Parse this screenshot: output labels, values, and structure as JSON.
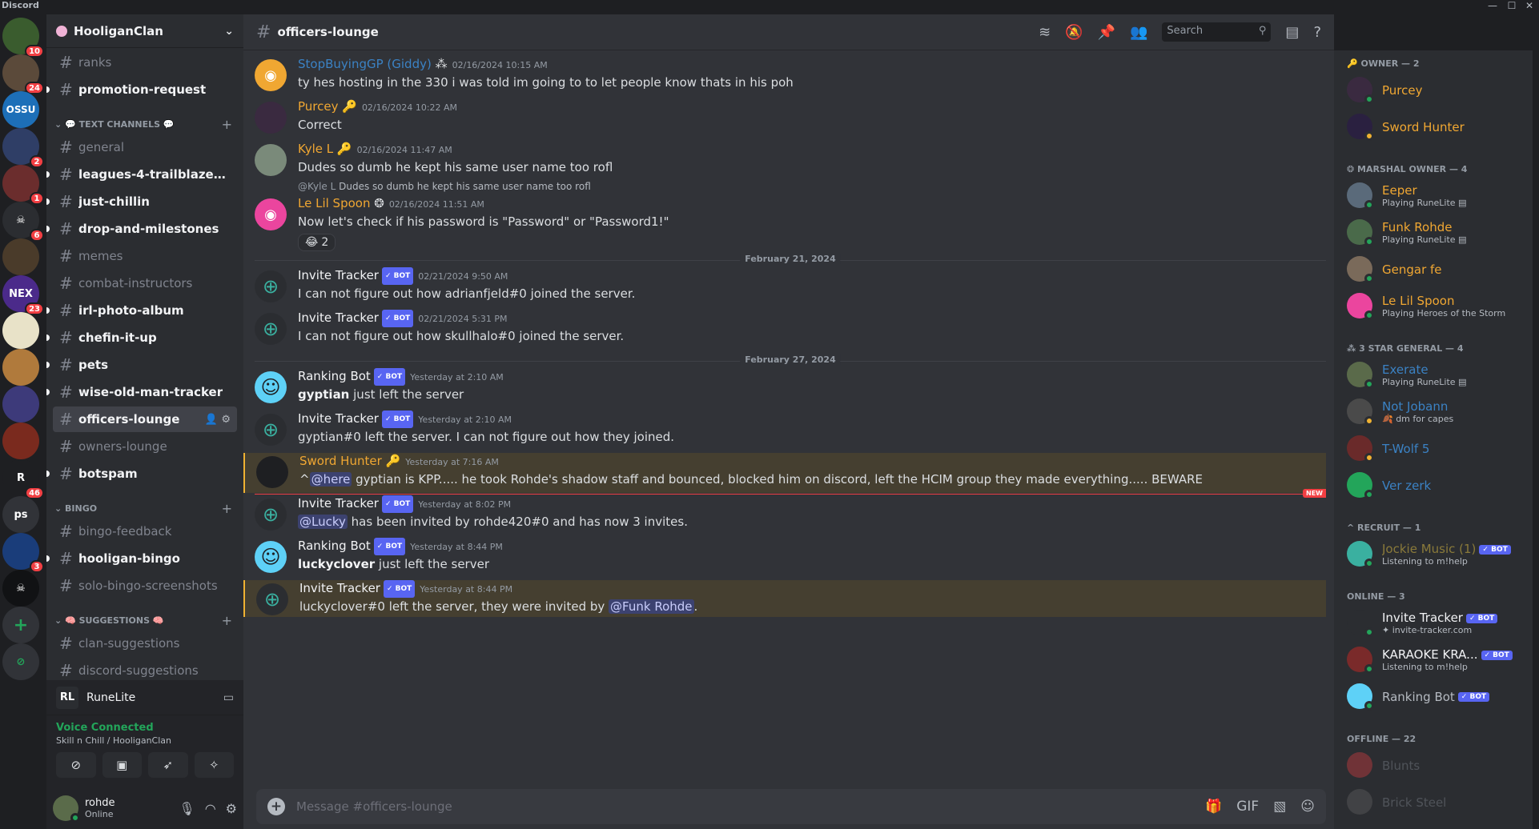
{
  "window": {
    "app_name": "Discord",
    "minimize": "—",
    "maximize": "☐",
    "close": "✕"
  },
  "servers": [
    {
      "label": "",
      "badge": "10",
      "color": "#3a5c2e"
    },
    {
      "label": "",
      "badge": "24",
      "color": "#5b4a3a"
    },
    {
      "label": "OSSU",
      "badge": "",
      "color": "#1d6fb8"
    },
    {
      "label": "",
      "badge": "2",
      "color": "#2f3e66"
    },
    {
      "label": "",
      "badge": "1",
      "color": "#6b2d2d"
    },
    {
      "label": "☠",
      "badge": "6",
      "color": "#2b2d31"
    },
    {
      "label": "",
      "badge": "",
      "color": "#4a3b2a"
    },
    {
      "label": "NEX",
      "badge": "23",
      "color": "#4b2a8a"
    },
    {
      "label": "",
      "badge": "",
      "color": "#e8e2c8"
    },
    {
      "label": "",
      "badge": "",
      "color": "#b07a3c"
    },
    {
      "label": "",
      "badge": "",
      "color": "#3d3a7a"
    },
    {
      "label": "",
      "badge": "",
      "color": "#7a2a1e"
    },
    {
      "label": "R",
      "badge": "46",
      "color": "#1e1f22"
    },
    {
      "label": "ps",
      "badge": "",
      "color": "#313338"
    },
    {
      "label": "",
      "badge": "3",
      "color": "#1a3d7a"
    },
    {
      "label": "☠",
      "badge": "",
      "color": "#111214"
    },
    {
      "label": "+",
      "badge": "",
      "color": "#313338"
    },
    {
      "label": "⊘",
      "badge": "",
      "color": "#313338"
    }
  ],
  "guild": {
    "name": "HooliganClan"
  },
  "channels": {
    "top": [
      {
        "name": "ranks",
        "state": "muted"
      },
      {
        "name": "promotion-request",
        "state": "unread"
      }
    ],
    "text_category": "💬 TEXT CHANNELS 💬",
    "text": [
      {
        "name": "general",
        "state": "muted"
      },
      {
        "name": "leagues-4-trailblazer-rel...",
        "state": "unread"
      },
      {
        "name": "just-chillin",
        "state": "unread"
      },
      {
        "name": "drop-and-milestones",
        "state": "unread"
      },
      {
        "name": "memes",
        "state": "muted"
      },
      {
        "name": "combat-instructors",
        "state": "muted"
      },
      {
        "name": "irl-photo-album",
        "state": "unread"
      },
      {
        "name": "chefin-it-up",
        "state": "unread"
      },
      {
        "name": "pets",
        "state": "unread"
      },
      {
        "name": "wise-old-man-tracker",
        "state": "unread"
      },
      {
        "name": "officers-lounge",
        "state": "active"
      },
      {
        "name": "owners-lounge",
        "state": "muted"
      },
      {
        "name": "botspam",
        "state": "unread"
      }
    ],
    "bingo_category": "BINGO",
    "bingo": [
      {
        "name": "bingo-feedback",
        "state": "muted"
      },
      {
        "name": "hooligan-bingo",
        "state": "unread"
      },
      {
        "name": "solo-bingo-screenshots",
        "state": "muted"
      }
    ],
    "suggestions_category": "🧠 SUGGESTIONS 🧠",
    "suggestions": [
      {
        "name": "clan-suggestions",
        "state": "muted"
      },
      {
        "name": "discord-suggestions",
        "state": "muted"
      }
    ]
  },
  "activity": {
    "logo": "RL",
    "name": "RuneLite"
  },
  "voice": {
    "status": "Voice Connected",
    "location": "Skill n Chill / HooliganClan"
  },
  "user": {
    "name": "rohde",
    "status": "Online"
  },
  "chat": {
    "channel": "officers-lounge",
    "search_placeholder": "Search",
    "composer_placeholder": "Message #officers-lounge",
    "messages": [
      {
        "author": "StopBuyingGP (Giddy)",
        "author_color": "#3b82c4",
        "flair": "⁂",
        "bot": false,
        "ts": "02/16/2024 10:15 AM",
        "text": "ty hes hosting in the 330 i was told im going to to let people know thats in his poh",
        "avatar_color": "#f0a732",
        "avatar_glyph": "◉"
      },
      {
        "author": "Purcey",
        "author_color": "#f0a732",
        "flair": "🔑",
        "bot": false,
        "ts": "02/16/2024 10:22 AM",
        "text": "Correct",
        "avatar_color": "#3a2a40",
        "avatar_glyph": ""
      },
      {
        "author": "Kyle L",
        "author_color": "#f0a732",
        "flair": "🔑",
        "bot": false,
        "ts": "02/16/2024 11:47 AM",
        "text": "Dudes so dumb he kept his same user name too rofl",
        "avatar_color": "#7a8a7a",
        "avatar_glyph": ""
      },
      {
        "reply_user": "@Kyle L",
        "reply_text": "Dudes so dumb he kept his same user name too rofl",
        "author": "Le Lil Spoon",
        "author_color": "#f0a732",
        "flair": "❂",
        "bot": false,
        "ts": "02/16/2024 11:51 AM",
        "text": "Now let's check if his password is \"Password\" or \"Password1!\"",
        "reaction": "😂",
        "reaction_count": "2",
        "avatar_color": "#eb459e",
        "avatar_glyph": "◉"
      },
      {
        "author": "Invite Tracker",
        "author_color": "#f2f3f5",
        "bot": true,
        "bot_label": "✓ BOT",
        "ts": "02/21/2024 9:50 AM",
        "text": "I can not figure out how adrianfjeld#0 joined the server.",
        "avatar_color": "#2b2d31",
        "avatar_glyph": "⊕"
      },
      {
        "author": "Invite Tracker",
        "author_color": "#f2f3f5",
        "bot": true,
        "bot_label": "✓ BOT",
        "ts": "02/21/2024 5:31 PM",
        "text": "I can not figure out how skullhalo#0 joined the server.",
        "avatar_color": "#2b2d31",
        "avatar_glyph": "⊕"
      },
      {
        "author": "Ranking Bot",
        "author_color": "#f2f3f5",
        "bot": true,
        "bot_label": "✓ BOT",
        "ts": "Yesterday at 2:10 AM",
        "bold": "gyptian",
        "text": " just left the server",
        "avatar_color": "#5ed1f7",
        "avatar_glyph": "☺"
      },
      {
        "author": "Invite Tracker",
        "author_color": "#f2f3f5",
        "bot": true,
        "bot_label": "✓ BOT",
        "ts": "Yesterday at 2:10 AM",
        "text": "gyptian#0 left the server. I can not figure out how they joined.",
        "avatar_color": "#2b2d31",
        "avatar_glyph": "⊕"
      },
      {
        "author": "Sword Hunter",
        "author_color": "#f0a732",
        "flair": "🔑",
        "bot": false,
        "ts": "Yesterday at 7:16 AM",
        "pre": "^",
        "mention": "@here",
        "text": " gyptian is KPP..... he took Rohde's shadow staff and bounced, blocked him on discord, left the HCIM group they made everything..... BEWARE",
        "avatar_color": "#1e1f22",
        "avatar_glyph": ""
      },
      {
        "author": "Invite Tracker",
        "author_color": "#f2f3f5",
        "bot": true,
        "bot_label": "✓ BOT",
        "ts": "Yesterday at 8:02 PM",
        "mention": "@Lucky",
        "text": " has been invited by rohde420#0 and has now 3 invites.",
        "avatar_color": "#2b2d31",
        "avatar_glyph": "⊕"
      },
      {
        "author": "Ranking Bot",
        "author_color": "#f2f3f5",
        "bot": true,
        "bot_label": "✓ BOT",
        "ts": "Yesterday at 8:44 PM",
        "bold": "luckyclover",
        "text": " just left the server",
        "avatar_color": "#5ed1f7",
        "avatar_glyph": "☺"
      },
      {
        "author": "Invite Tracker",
        "author_color": "#f2f3f5",
        "bot": true,
        "bot_label": "✓ BOT",
        "ts": "Yesterday at 8:44 PM",
        "text": "luckyclover#0 left the server, they were invited by ",
        "mention_end": "@Funk Rohde",
        "text_end": ".",
        "avatar_color": "#2b2d31",
        "avatar_glyph": "⊕"
      }
    ],
    "dividers": [
      "February 21, 2024",
      "February 27, 2024"
    ],
    "new_label": "NEW"
  },
  "members": {
    "groups": [
      {
        "title": "🔑 OWNER — 2",
        "items": [
          {
            "name": "Purcey",
            "color": "#f0a732",
            "sub": "",
            "status": "#23a55a",
            "av": "#3a2a40"
          },
          {
            "name": "Sword Hunter",
            "color": "#f0a732",
            "sub": "",
            "status": "#f0b232",
            "av": "#2a2040"
          }
        ]
      },
      {
        "title": "❂ MARSHAL OWNER — 4",
        "items": [
          {
            "name": "Eeper",
            "color": "#f0a732",
            "sub": "Playing RuneLite ▤",
            "status": "#23a55a",
            "av": "#5a6a7a"
          },
          {
            "name": "Funk Rohde",
            "color": "#f0a732",
            "sub": "Playing RuneLite ▤",
            "status": "#23a55a",
            "av": "#4a6a4a"
          },
          {
            "name": "Gengar fe",
            "color": "#f0a732",
            "sub": "",
            "status": "#23a55a",
            "av": "#7a6a5a"
          },
          {
            "name": "Le Lil Spoon",
            "color": "#f0a732",
            "sub": "Playing Heroes of the Storm",
            "status": "#23a55a",
            "av": "#eb459e"
          }
        ]
      },
      {
        "title": "⁂ 3 STAR GENERAL — 4",
        "items": [
          {
            "name": "Exerate",
            "color": "#3b82c4",
            "sub": "Playing RuneLite ▤",
            "status": "#23a55a",
            "av": "#5a6a4a"
          },
          {
            "name": "Not Jobann",
            "color": "#3b82c4",
            "sub": "🍂 dm for capes",
            "status": "#f0b232",
            "av": "#4a4a4a"
          },
          {
            "name": "T-Wolf 5",
            "color": "#3b82c4",
            "sub": "",
            "status": "#f0b232",
            "av": "#6a2a2a"
          },
          {
            "name": "Ver zerk",
            "color": "#3b82c4",
            "sub": "",
            "status": "#23a55a",
            "av": "#23a55a"
          }
        ]
      },
      {
        "title": "^ RECRUIT — 1",
        "items": [
          {
            "name": "Jockie Music (1)",
            "color": "#8a7a3a",
            "sub": "Listening to m!help",
            "status": "#23a55a",
            "av": "#3ab0a0",
            "bot": "✓ BOT"
          }
        ]
      },
      {
        "title": "ONLINE — 3",
        "items": [
          {
            "name": "Invite Tracker",
            "color": "#f2f3f5",
            "sub": "✦ invite-tracker.com",
            "status": "#23a55a",
            "av": "#2b2d31",
            "bot": "✓ BOT"
          },
          {
            "name": "KARAOKE KRA...",
            "color": "#f2f3f5",
            "sub": "Listening to m!help",
            "status": "#23a55a",
            "av": "#7a2a2a",
            "bot": "✓ BOT"
          },
          {
            "name": "Ranking Bot",
            "color": "#b5bac1",
            "sub": "",
            "status": "#23a55a",
            "av": "#5ed1f7",
            "bot": "✓ BOT"
          }
        ]
      },
      {
        "title": "OFFLINE — 22",
        "items": [
          {
            "name": "Blunts",
            "color": "#949ba4",
            "sub": "",
            "status": "",
            "av": "#f23f43",
            "off": true
          },
          {
            "name": "Brick Steel",
            "color": "#949ba4",
            "sub": "",
            "status": "",
            "av": "#6a6a6a",
            "off": true
          }
        ]
      }
    ]
  }
}
